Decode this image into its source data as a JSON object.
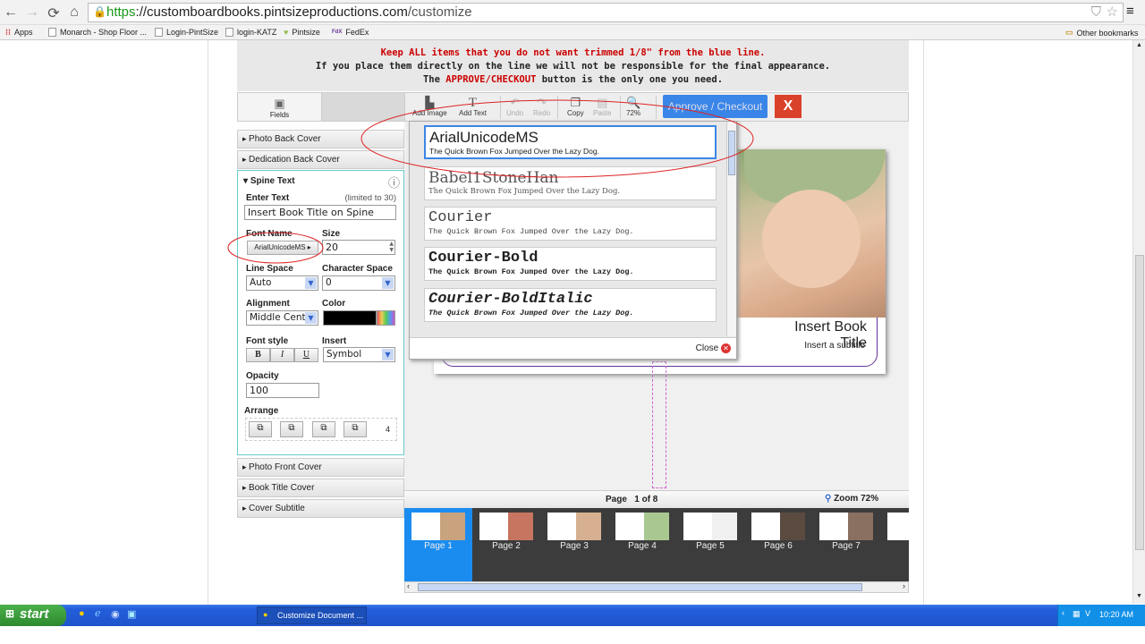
{
  "browser": {
    "url_scheme": "https",
    "url_host": "://customboardbooks.pintsizeproductions.com",
    "url_path": "/customize",
    "bookmarks": [
      "Apps",
      "Monarch - Shop Floor ...",
      "Login-PintSize",
      "login-KATZ",
      "Pintsize",
      "FedEx"
    ],
    "other_bookmarks": "Other bookmarks"
  },
  "notice": {
    "line1": "Keep ALL items that you do not want trimmed 1/8\" from the blue line.",
    "line2": "If you place them directly on the line we will not be responsible for the final appearance.",
    "line3_pre": "The ",
    "line3_em": "APPROVE/CHECKOUT",
    "line3_post": " button is the only one you need."
  },
  "toolbar": {
    "fields": "Fields",
    "add_image": "Add Image",
    "add_text": "Add Text",
    "undo": "Undo",
    "redo": "Redo",
    "copy": "Copy",
    "paste": "Paste",
    "zoom": "72%",
    "approve": "Approve / Checkout",
    "close": "X"
  },
  "sidebar": {
    "sections": [
      "Photo Back Cover",
      "Dedication Back Cover",
      "Spine Text",
      "Photo Front Cover",
      "Book Title Cover",
      "Cover Subtitle"
    ],
    "spine": {
      "title": "Spine Text",
      "enter_text_label": "Enter Text",
      "limit": "(limited to 30)",
      "text_value": "Insert Book Title on Spine",
      "font_name_label": "Font Name",
      "font_name": "ArialUnicodeMS",
      "size_label": "Size",
      "size": "20",
      "line_space_label": "Line Space",
      "line_space": "Auto",
      "char_space_label": "Character Space",
      "char_space": "0",
      "alignment_label": "Alignment",
      "alignment": "Middle Cent",
      "color_label": "Color",
      "color": "#000000",
      "font_style_label": "Font style",
      "bold": "B",
      "italic": "I",
      "underline": "U",
      "insert_label": "Insert",
      "insert": "Symbol",
      "opacity_label": "Opacity",
      "opacity": "100",
      "arrange_label": "Arrange",
      "arrange_count": "4"
    }
  },
  "font_picker": {
    "sample": "The Quick Brown Fox Jumped Over the Lazy Dog.",
    "fonts": [
      "ArialUnicodeMS",
      "Babel1StoneHan",
      "Courier",
      "Courier-Bold",
      "Courier-BoldItalic"
    ],
    "selected": "ArialUnicodeMS",
    "close": "Close"
  },
  "book": {
    "title": "Insert Book Title",
    "subtitle": "Insert a subtitle"
  },
  "pagebar": {
    "page_label": "Page",
    "page_value": "1 of 8",
    "zoom": "Zoom 72%"
  },
  "thumbnails": [
    "Page 1",
    "Page 2",
    "Page 3",
    "Page 4",
    "Page 5",
    "Page 6",
    "Page 7",
    "Pa"
  ],
  "taskbar": {
    "start": "start",
    "task": "Customize Document ...",
    "clock": "10:20 AM"
  }
}
